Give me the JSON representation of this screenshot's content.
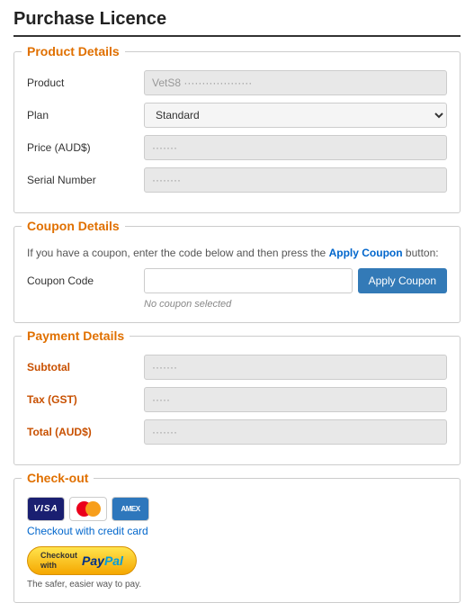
{
  "page": {
    "title": "Purchase Licence"
  },
  "product_details": {
    "legend": "Product Details",
    "fields": [
      {
        "label": "Product",
        "value": "VetS8",
        "type": "text",
        "placeholder": "VetS8 product info"
      },
      {
        "label": "Plan",
        "value": "Standard",
        "type": "select",
        "options": [
          "Standard"
        ]
      },
      {
        "label": "Price (AUD$)",
        "value": "",
        "type": "text"
      },
      {
        "label": "Serial Number",
        "value": "",
        "type": "text"
      }
    ]
  },
  "coupon_details": {
    "legend": "Coupon Details",
    "info": "If you have a coupon, enter the code below and then press the ",
    "info_link": "Apply Coupon",
    "info_suffix": " button:",
    "coupon_label": "Coupon Code",
    "coupon_placeholder": "",
    "no_coupon_text": "No coupon selected",
    "apply_button_label": "Apply Coupon"
  },
  "payment_details": {
    "legend": "Payment Details",
    "fields": [
      {
        "label": "Subtotal",
        "value": ""
      },
      {
        "label": "Tax (GST)",
        "value": ""
      },
      {
        "label": "Total (AUD$)",
        "value": ""
      }
    ]
  },
  "checkout": {
    "legend": "Check-out",
    "credit_card_label": "Checkout with credit card",
    "paypal_line1": "Checkout",
    "paypal_line2": "with",
    "paypal_pay": "Pay",
    "paypal_pal": "Pal",
    "paypal_subtitle": "The safer, easier way to pay."
  }
}
